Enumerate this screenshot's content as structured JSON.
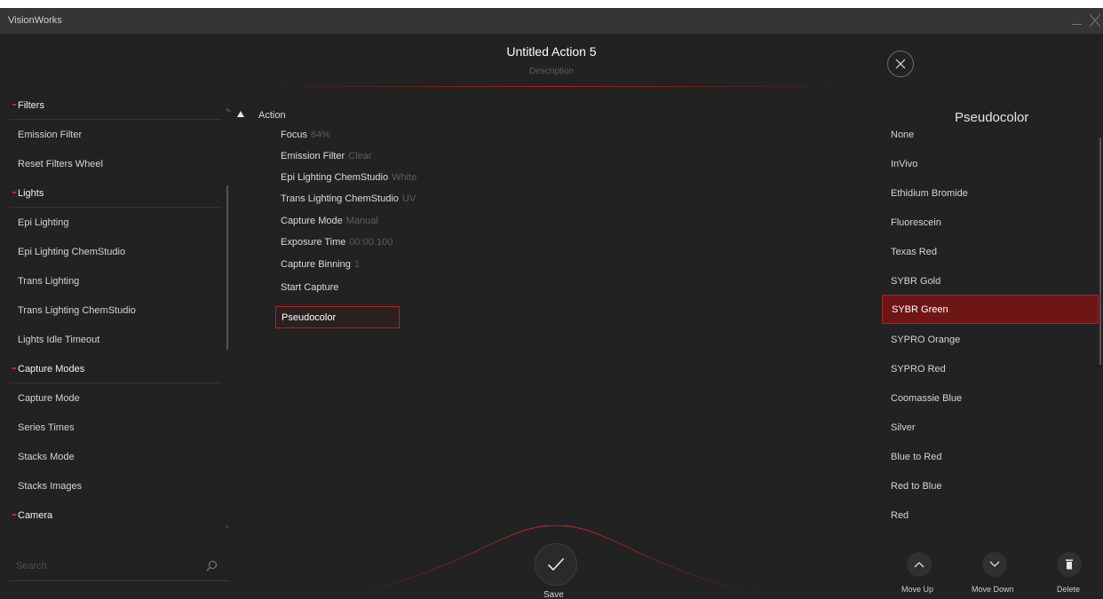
{
  "app": {
    "title": "VisionWorks"
  },
  "header": {
    "title": "Untitled Action 5",
    "description": "Description"
  },
  "sidebar": {
    "items": [
      {
        "label": "Filters",
        "type": "header"
      },
      {
        "label": "Emission Filter",
        "type": "item"
      },
      {
        "label": "Reset Filters Wheel",
        "type": "item"
      },
      {
        "label": "Lights",
        "type": "header"
      },
      {
        "label": "Epi Lighting",
        "type": "item"
      },
      {
        "label": "Epi Lighting ChemStudio",
        "type": "item"
      },
      {
        "label": "Trans Lighting",
        "type": "item"
      },
      {
        "label": "Trans Lighting ChemStudio",
        "type": "item"
      },
      {
        "label": "Lights Idle Timeout",
        "type": "item"
      },
      {
        "label": "Capture Modes",
        "type": "header"
      },
      {
        "label": "Capture Mode",
        "type": "item"
      },
      {
        "label": "Series Times",
        "type": "item"
      },
      {
        "label": "Stacks Mode",
        "type": "item"
      },
      {
        "label": "Stacks Images",
        "type": "item"
      },
      {
        "label": "Camera",
        "type": "header"
      }
    ],
    "search_placeholder": "Search"
  },
  "action": {
    "root": "Action",
    "steps": [
      {
        "label": "Focus",
        "value": "64%"
      },
      {
        "label": "Emission Filter",
        "value": "Clear"
      },
      {
        "label": "Epi Lighting ChemStudio",
        "value": "White"
      },
      {
        "label": "Trans Lighting ChemStudio",
        "value": "UV"
      },
      {
        "label": "Capture Mode",
        "value": "Manual"
      },
      {
        "label": "Exposure Time",
        "value": "00:00.100"
      },
      {
        "label": "Capture Binning",
        "value": "1"
      },
      {
        "label": "Start Capture",
        "value": ""
      }
    ],
    "selected_step": "Pseudocolor"
  },
  "pseudocolor": {
    "title": "Pseudocolor",
    "options": [
      "None",
      "InVivo",
      "Ethidium Bromide",
      "Fluorescein",
      "Texas Red",
      "SYBR Gold",
      "SYBR Green",
      "SYPRO Orange",
      "SYPRO Red",
      "Coomassie Blue",
      "Silver",
      "Blue to Red",
      "Red to Blue",
      "Red"
    ],
    "selected": "SYBR Green",
    "buttons": {
      "move_up": "Move Up",
      "move_down": "Move Down",
      "delete": "Delete"
    }
  },
  "footer": {
    "save_label": "Save"
  },
  "colors": {
    "accent": "#b02121",
    "selected_bg": "#6e1515",
    "background": "#222222"
  }
}
